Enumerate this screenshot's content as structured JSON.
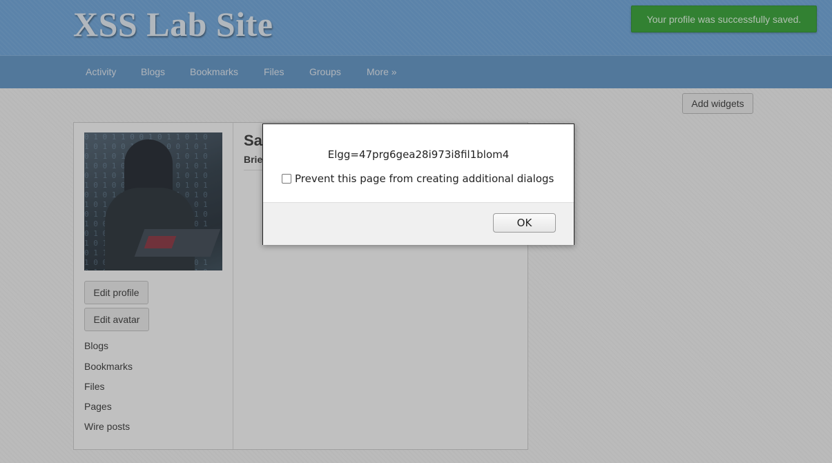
{
  "site": {
    "title": "XSS Lab Site"
  },
  "nav": {
    "items": [
      "Activity",
      "Blogs",
      "Bookmarks",
      "Files",
      "Groups",
      "More »"
    ]
  },
  "notification": {
    "text": "Your profile was successfully saved."
  },
  "widgets": {
    "add_label": "Add widgets"
  },
  "profile": {
    "name_fragment": "Sa",
    "brief_fragment": "Brie",
    "buttons": {
      "edit_profile": "Edit profile",
      "edit_avatar": "Edit avatar"
    },
    "links": [
      "Blogs",
      "Bookmarks",
      "Files",
      "Pages",
      "Wire posts"
    ]
  },
  "dialog": {
    "message": "Elgg=47prg6gea28i973i8fil1blom4",
    "checkbox_label": "Prevent this page from creating additional dialogs",
    "checkbox_checked": false,
    "ok_label": "OK"
  }
}
